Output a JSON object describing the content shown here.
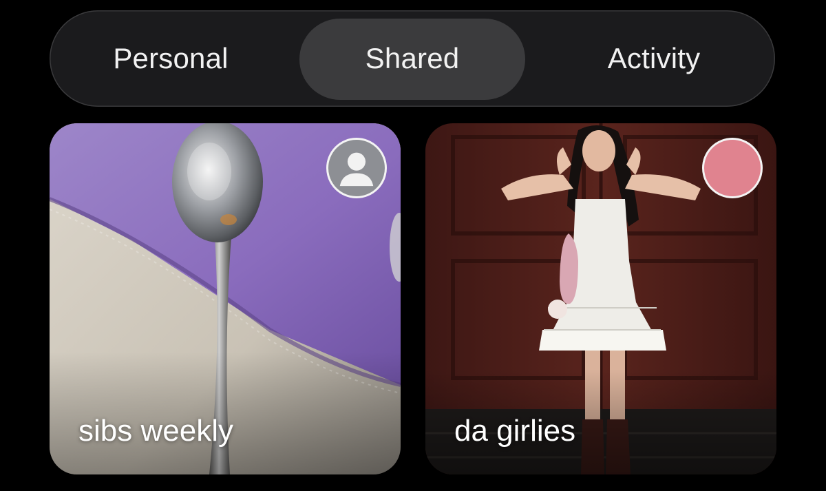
{
  "tabs": {
    "personal_label": "Personal",
    "shared_label": "Shared",
    "activity_label": "Activity",
    "selected": "Shared"
  },
  "albums": [
    {
      "title": "sibs weekly",
      "avatar_icon": "person-placeholder-icon"
    },
    {
      "title": "da girlies",
      "avatar_color": "#e0838f"
    }
  ],
  "colors": {
    "background": "#000000",
    "segmented_bg": "#1b1b1d",
    "selected_pill": "#3b3b3d"
  }
}
